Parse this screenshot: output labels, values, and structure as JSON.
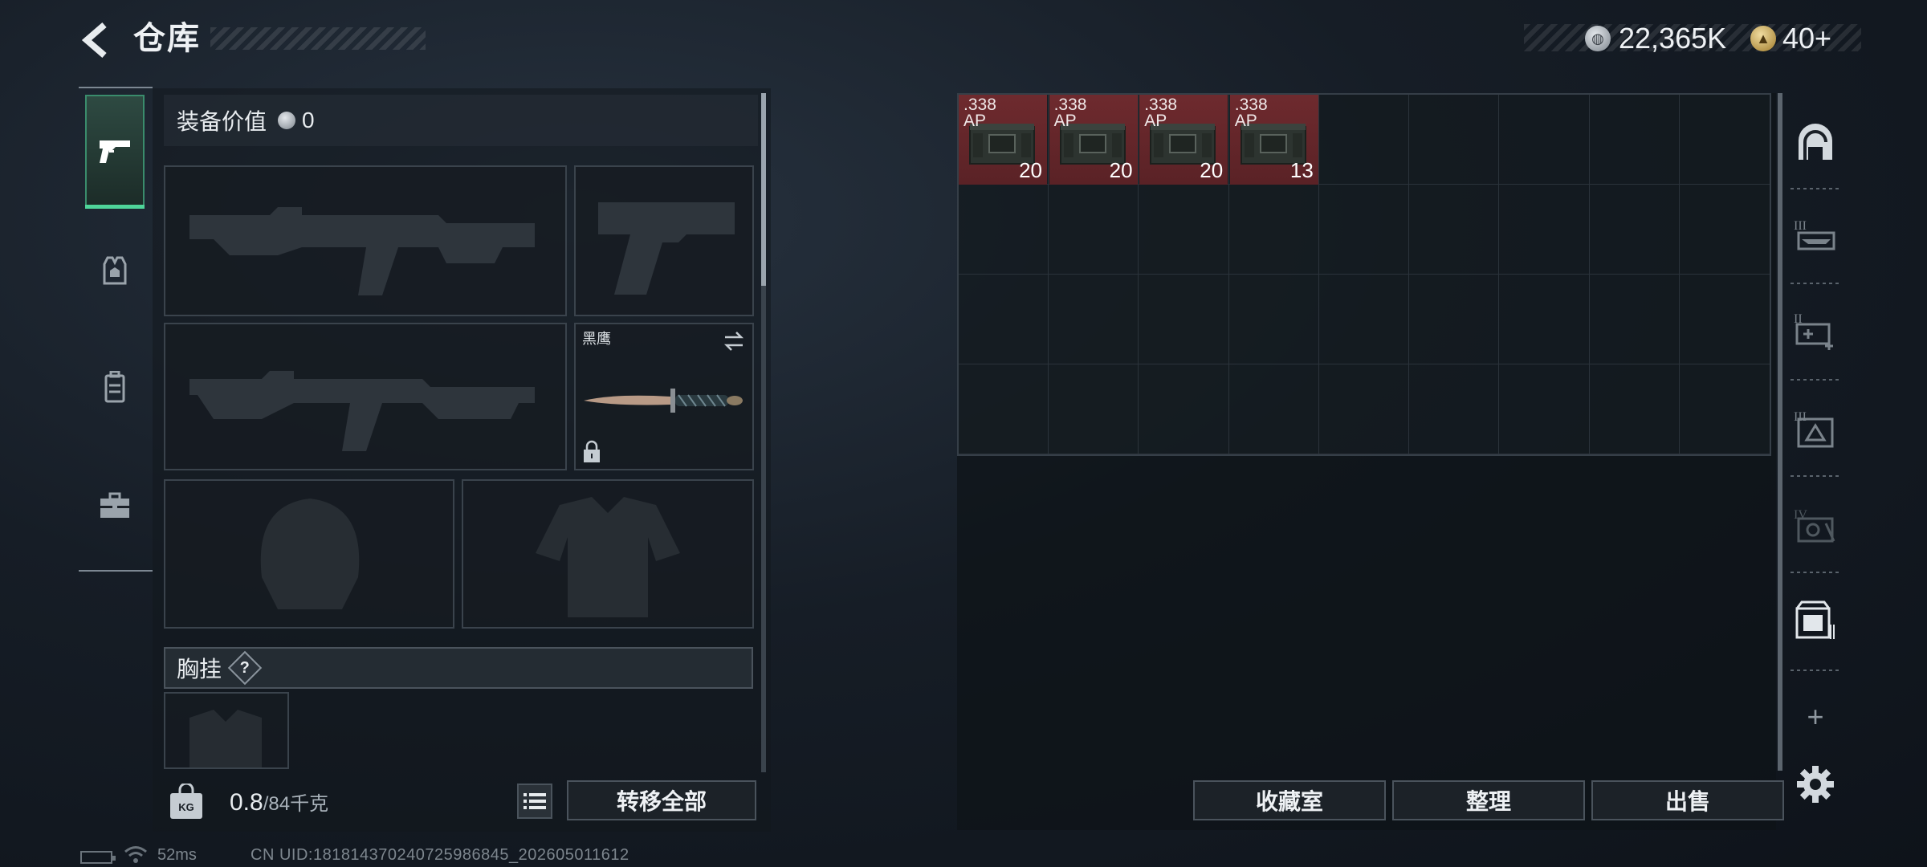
{
  "header": {
    "title": "仓库",
    "currency": {
      "coins": "22,365K",
      "tokens": "40+"
    }
  },
  "category_tabs": [
    {
      "name": "weapons",
      "icon": "pistol-icon",
      "active": true
    },
    {
      "name": "armor",
      "icon": "helmet-icon",
      "active": false
    },
    {
      "name": "backpack",
      "icon": "backpack-icon",
      "active": false
    },
    {
      "name": "case",
      "icon": "toolbox-icon",
      "active": false
    }
  ],
  "loadout": {
    "equip_value_label": "装备价值",
    "equip_value": "0",
    "slots": {
      "primary": {
        "icon": "rifle-icon"
      },
      "pistol": {
        "icon": "pistol-icon"
      },
      "secondary": {
        "icon": "rifle-icon"
      },
      "melee": {
        "name": "黑鹰",
        "icon": "knife-icon",
        "locked": true
      },
      "helmet": {
        "icon": "helmet-icon"
      },
      "armor": {
        "icon": "body-armor-icon"
      }
    },
    "chest_rig_label": "胸挂",
    "help_glyph": "?",
    "weight_current": "0.8",
    "weight_max": "/84千克",
    "transfer_all_label": "转移全部"
  },
  "storage": {
    "columns": 9,
    "rows": 4,
    "items": [
      {
        "caliber": ".338",
        "type": "AP",
        "qty": "20",
        "color": "#6e2a2e"
      },
      {
        "caliber": ".338",
        "type": "AP",
        "qty": "20",
        "color": "#6e2a2e"
      },
      {
        "caliber": ".338",
        "type": "AP",
        "qty": "20",
        "color": "#6e2a2e"
      },
      {
        "caliber": ".338",
        "type": "AP",
        "qty": "13",
        "color": "#6e2a2e"
      }
    ]
  },
  "side_rail": [
    {
      "name": "main-storage",
      "icon": "storage-arch-icon"
    },
    {
      "name": "storage-tier-3",
      "icon": "weapon-rack-icon"
    },
    {
      "name": "storage-tier-2",
      "icon": "medkit-rack-icon"
    },
    {
      "name": "storage-tier-3b",
      "icon": "warning-box-icon"
    },
    {
      "name": "storage-tier-4",
      "icon": "tools-box-icon"
    },
    {
      "name": "storage-crate",
      "icon": "crate-icon"
    }
  ],
  "actions": {
    "collection_label": "收藏室",
    "organize_label": "整理",
    "sell_label": "出售",
    "add_glyph": "+"
  },
  "status": {
    "ping": "52ms",
    "uid": "CN UID:181814370240725986845_202605011612"
  },
  "colors": {
    "accent_green": "#4fd59a",
    "ammo_red": "#6e2a2e",
    "panel_border": "#4a535c"
  }
}
